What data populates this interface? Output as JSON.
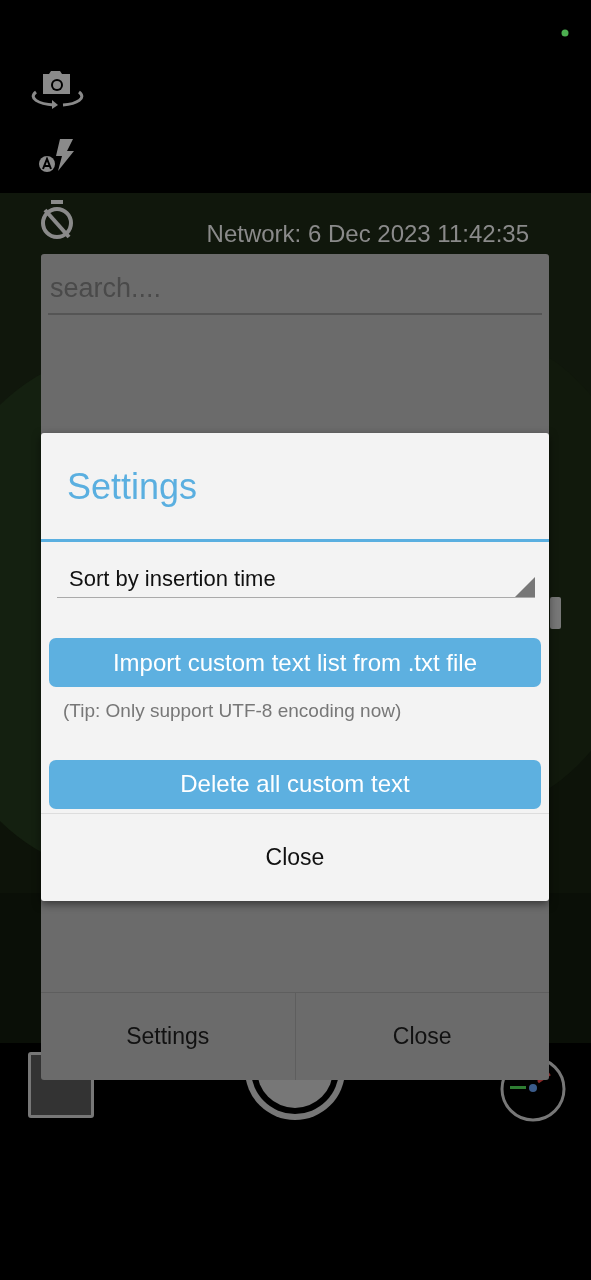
{
  "camera": {
    "network_time": "Network: 6 Dec 2023 11:42:35"
  },
  "panel": {
    "search": {
      "placeholder": "search...."
    },
    "buttons": [
      {
        "label": "Settings"
      },
      {
        "label": "Close"
      }
    ]
  },
  "dialog": {
    "title": "Settings",
    "sort": {
      "value": "Sort by insertion time"
    },
    "import_button": "Import custom text list from .txt file",
    "tip": "(Tip: Only support UTF-8 encoding now)",
    "delete_button": "Delete all custom text",
    "close_button": "Close"
  }
}
